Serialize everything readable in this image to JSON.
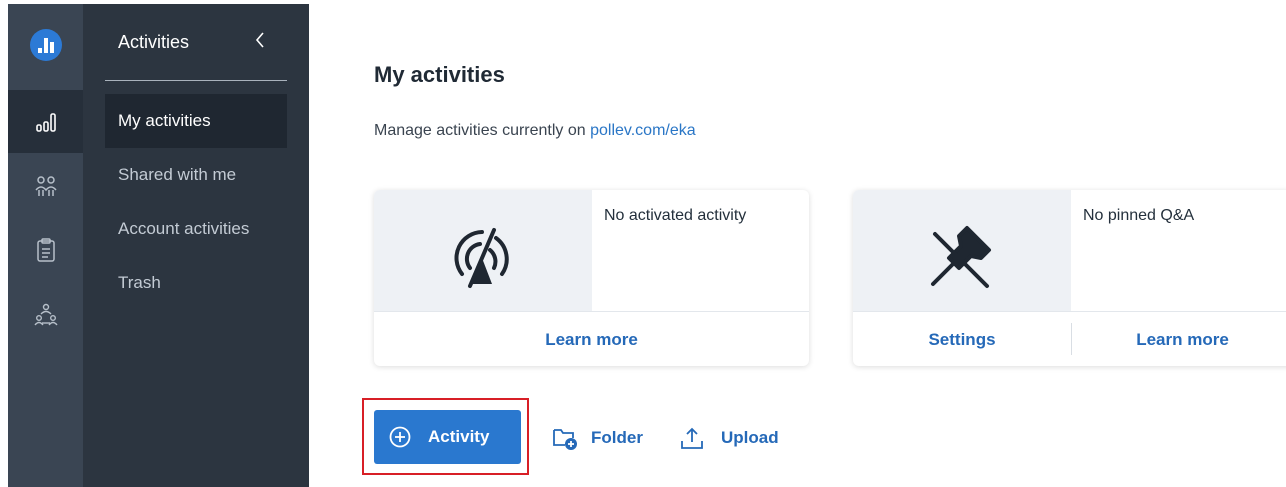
{
  "colors": {
    "accent": "#2a78cf",
    "link": "#2569b8",
    "rail_bg": "#3a4553",
    "sidebar_bg": "#2c3540",
    "highlight": "#d81f26"
  },
  "rail": {
    "items": [
      {
        "icon": "activities-chart-icon"
      },
      {
        "icon": "participants-icon"
      },
      {
        "icon": "clipboard-icon"
      },
      {
        "icon": "groups-icon"
      }
    ]
  },
  "sidebar": {
    "title": "Activities",
    "collapse_icon": "chevron-left-icon",
    "items": [
      {
        "label": "My activities"
      },
      {
        "label": "Shared with me"
      },
      {
        "label": "Account activities"
      },
      {
        "label": "Trash"
      }
    ]
  },
  "main": {
    "title": "My activities",
    "subtitle_prefix": "Manage activities currently on ",
    "subtitle_link": "pollev.com/eka",
    "cards": [
      {
        "icon": "no-broadcast-icon",
        "text": "No activated activity",
        "links": [
          "Learn more"
        ]
      },
      {
        "icon": "unpin-icon",
        "text": "No pinned Q&A",
        "links": [
          "Settings",
          "Learn more"
        ]
      }
    ],
    "toolbar": {
      "activity_label": "Activity",
      "activity_icon": "plus-circle-icon",
      "folder_label": "Folder",
      "folder_icon": "folder-add-icon",
      "upload_label": "Upload",
      "upload_icon": "upload-icon"
    }
  }
}
